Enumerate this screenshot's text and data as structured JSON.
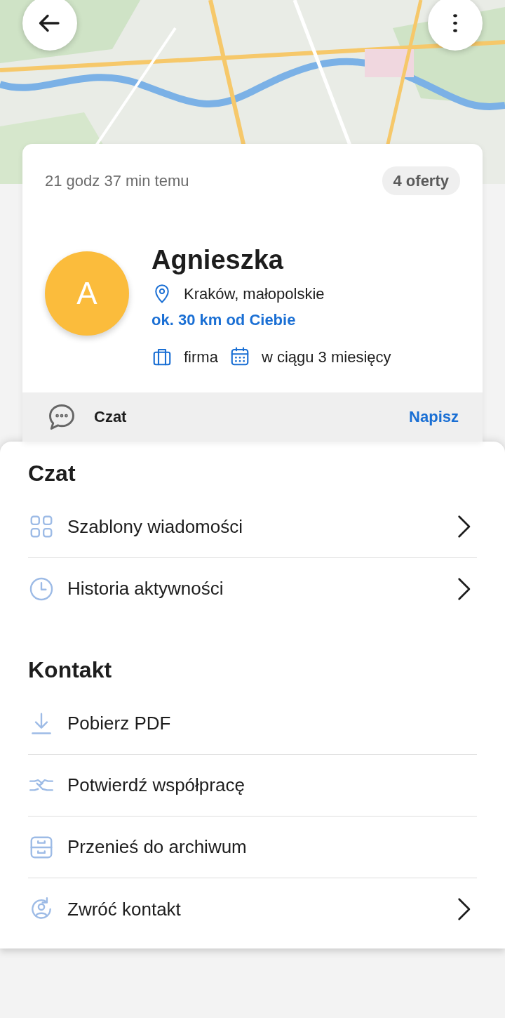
{
  "card": {
    "time_ago": "21 godz 37 min temu",
    "offers_badge": "4 oferty",
    "avatar_letter": "A",
    "name": "Agnieszka",
    "location": "Kraków, małopolskie",
    "distance": "ok. 30 km od Ciebie",
    "tags": [
      {
        "kind": "business",
        "label": "firma"
      },
      {
        "kind": "timeframe",
        "label": "w ciągu 3 miesięcy"
      }
    ],
    "chat": {
      "label": "Czat",
      "action": "Napisz"
    }
  },
  "sheet": {
    "sections": [
      {
        "title": "Czat",
        "items": [
          {
            "kind": "templates",
            "label": "Szablony wiadomości",
            "chevron": true
          },
          {
            "kind": "history",
            "label": "Historia aktywności",
            "chevron": true
          }
        ]
      },
      {
        "title": "Kontakt",
        "items": [
          {
            "kind": "pdf",
            "label": "Pobierz PDF",
            "chevron": false
          },
          {
            "kind": "confirm",
            "label": "Potwierdź współpracę",
            "chevron": false
          },
          {
            "kind": "archive",
            "label": "Przenieś do archiwum",
            "chevron": false
          },
          {
            "kind": "return",
            "label": "Zwróć kontakt",
            "chevron": true
          }
        ]
      }
    ]
  }
}
